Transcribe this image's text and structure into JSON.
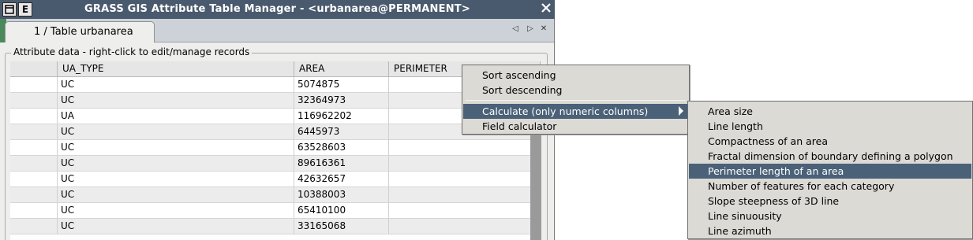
{
  "window": {
    "title": "GRASS GIS Attribute Table Manager - <urbanarea@PERMANENT>",
    "menu_button_label": "E"
  },
  "tab": {
    "label": "1 / Table urbanarea"
  },
  "panel": {
    "legend": "Attribute data - right-click to edit/manage records"
  },
  "table": {
    "columns": [
      "",
      "UA_TYPE",
      "AREA",
      "PERIMETER"
    ],
    "rows": [
      {
        "ua_type": "UC",
        "area": "5074875"
      },
      {
        "ua_type": "UC",
        "area": "32364973"
      },
      {
        "ua_type": "UA",
        "area": "116962202"
      },
      {
        "ua_type": "UC",
        "area": "6445973"
      },
      {
        "ua_type": "UC",
        "area": "63528603"
      },
      {
        "ua_type": "UC",
        "area": "89616361"
      },
      {
        "ua_type": "UC",
        "area": "42632657"
      },
      {
        "ua_type": "UC",
        "area": "10388003"
      },
      {
        "ua_type": "UC",
        "area": "65410100"
      },
      {
        "ua_type": "UC",
        "area": "33165068"
      }
    ]
  },
  "context_menu": {
    "items": [
      "Sort ascending",
      "Sort descending",
      "Calculate (only numeric columns)",
      "Field calculator"
    ]
  },
  "submenu": {
    "items": [
      "Area size",
      "Line length",
      "Compactness of an area",
      "Fractal dimension of boundary defining a polygon",
      "Perimeter length of an area",
      "Number of features for each category",
      "Slope steepness of 3D line",
      "Line sinuousity",
      "Line azimuth"
    ]
  },
  "colors": {
    "titlebar": "#4a5a6e",
    "highlight": "#4a6178",
    "menu_bg": "#dcdad5"
  },
  "icons": {
    "window_menu": "window-menu-icon",
    "close": "close-icon",
    "tab_left": "tab-scroll-left-icon",
    "tab_right": "tab-scroll-right-icon",
    "tab_close": "tab-close-icon",
    "submenu_arrow": "submenu-arrow-icon"
  }
}
